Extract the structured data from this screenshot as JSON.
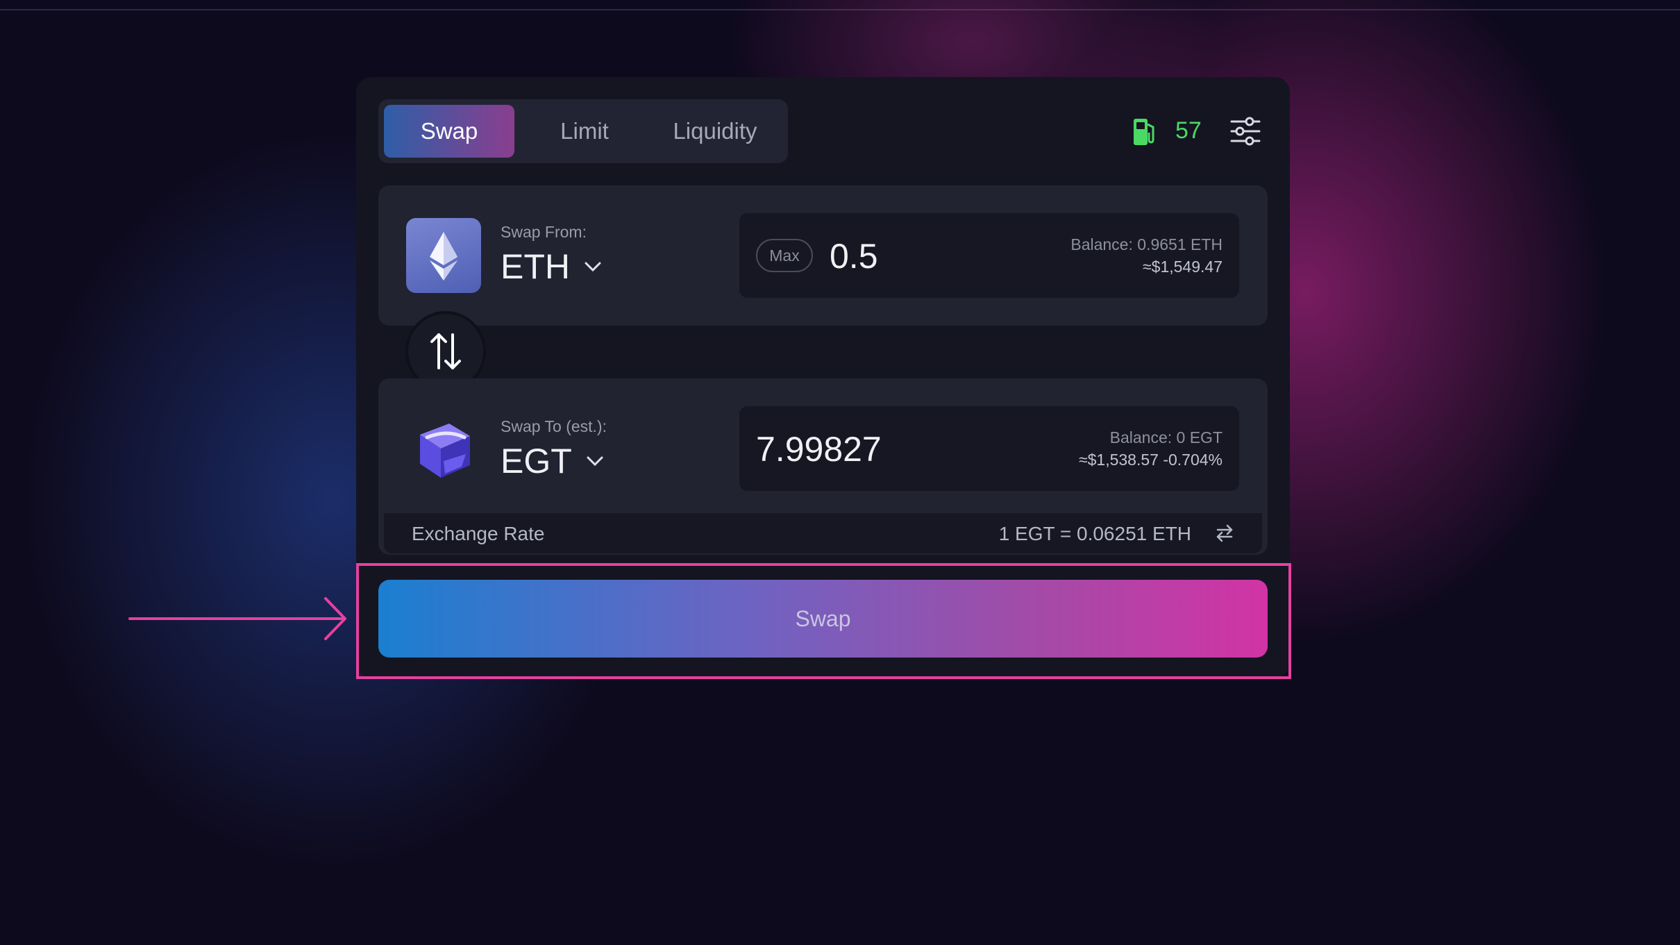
{
  "tabs": [
    {
      "label": "Swap",
      "active": true
    },
    {
      "label": "Limit",
      "active": false
    },
    {
      "label": "Liquidity",
      "active": false
    }
  ],
  "gas": {
    "icon": "gas-pump-icon",
    "value": "57",
    "color": "#4bd964"
  },
  "settings": {
    "icon": "sliders-icon"
  },
  "swap_from": {
    "label": "Swap From:",
    "token": "ETH",
    "token_icon": "ethereum-icon",
    "max_label": "Max",
    "amount": "0.5",
    "balance": "Balance: 0.9651 ETH",
    "usd_value": "≈$1,549.47"
  },
  "flip": {
    "icon": "swap-vertical-arrows-icon"
  },
  "swap_to": {
    "label": "Swap To (est.):",
    "token": "EGT",
    "token_icon": "egt-cube-icon",
    "amount": "7.99827",
    "balance": "Balance: 0 EGT",
    "usd_value": "≈$1,538.57 -0.704%"
  },
  "exchange_rate": {
    "label": "Exchange Rate",
    "value": "1 EGT = 0.06251 ETH",
    "icon": "swap-horizontal-icon"
  },
  "swap_button": {
    "label": "Swap"
  },
  "colors": {
    "accent_pink": "#e6419f",
    "gradient_start": "#1b7fd0",
    "gradient_end": "#d233a5",
    "card_bg": "#141521"
  }
}
